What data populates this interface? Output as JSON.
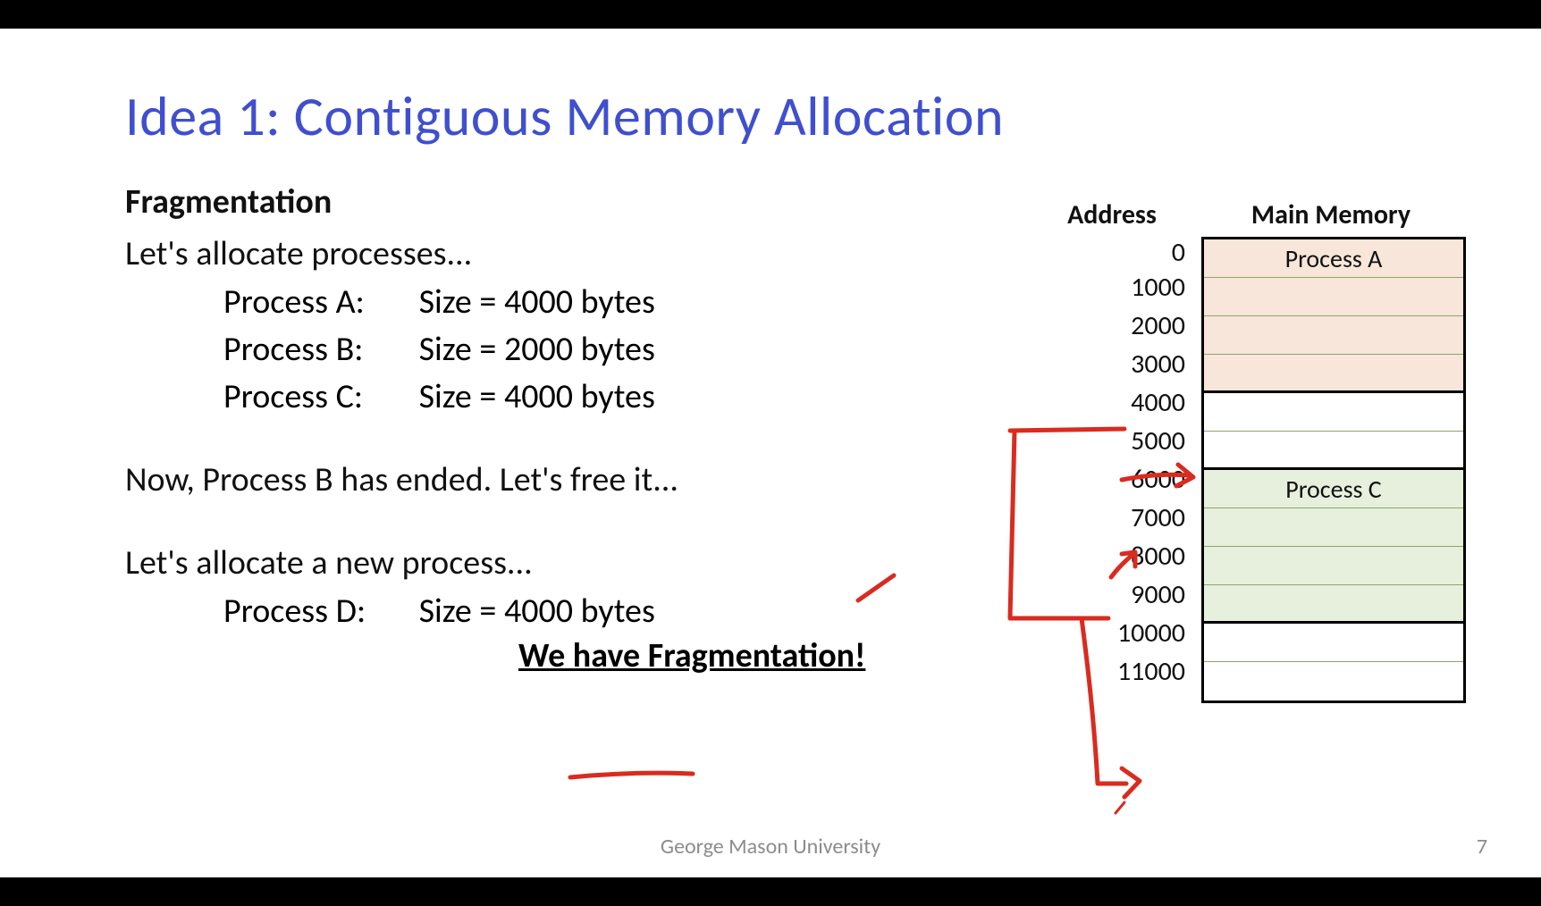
{
  "slide": {
    "title": "Idea 1: Contiguous Memory Allocation",
    "subhead": "Fragmentation",
    "line_alloc": "Let's allocate processes...",
    "processes": [
      {
        "name": "Process A:",
        "size": "Size = 4000 bytes"
      },
      {
        "name": "Process B:",
        "size": "Size = 2000 bytes"
      },
      {
        "name": "Process C:",
        "size": "Size = 4000 bytes"
      }
    ],
    "line_free": "Now, Process B has ended.  Let's free it...",
    "line_new": "Let's allocate a new process...",
    "process_d": {
      "name": "Process D:",
      "size": "Size = 4000 bytes"
    },
    "fragmentation": "We have Fragmentation!"
  },
  "memory": {
    "header_addr": "Address",
    "header_mem": "Main Memory",
    "addresses": [
      "0",
      "1000",
      "2000",
      "3000",
      "4000",
      "5000",
      "6000",
      "7000",
      "8000",
      "9000",
      "10000",
      "11000"
    ],
    "blocks": [
      {
        "label": "Process A",
        "color": "proc-a",
        "rows": 4
      },
      {
        "label": "",
        "color": "free",
        "rows": 2
      },
      {
        "label": "Process C",
        "color": "proc-c",
        "rows": 4
      },
      {
        "label": "",
        "color": "free",
        "rows": 2
      }
    ]
  },
  "footer": {
    "center": "George Mason University",
    "page": "7"
  },
  "colors": {
    "title": "#3f4fcf",
    "proc_a_bg": "#f7e6d9",
    "proc_c_bg": "#e6f0dc",
    "annotation": "#d92b1f"
  }
}
